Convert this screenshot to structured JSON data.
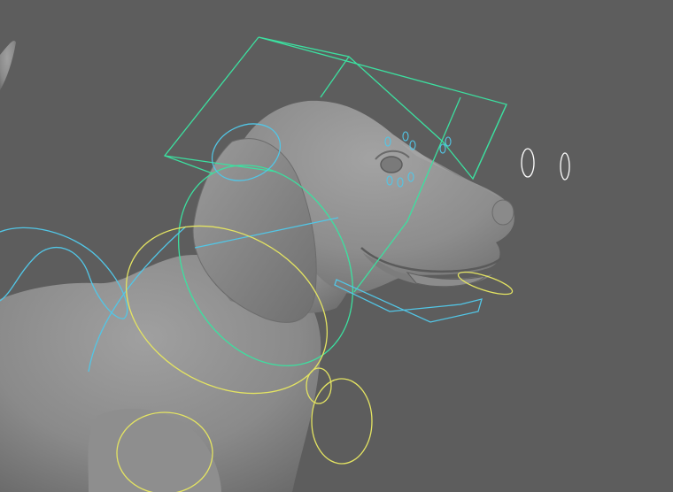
{
  "viewport": {
    "label": "",
    "background_color": "#5d5d5d"
  },
  "model": {
    "name": "",
    "shading_color": "#8e8e8e",
    "shadow_color": "#4f4f4f",
    "highlight_color": "#a2a2a2"
  },
  "rig": {
    "colors": {
      "head_cage": "#3ce0a0",
      "fk_controls": "#52c6e6",
      "ik_controls": "#e4e462",
      "locator": "#ffffff"
    },
    "controls": [
      {
        "name": "head-cage-control",
        "color_key": "head_cage"
      },
      {
        "name": "neck-ring-control",
        "color_key": "head_cage"
      },
      {
        "name": "ear-control",
        "color_key": "fk_controls"
      },
      {
        "name": "eyelid-controls",
        "color_key": "fk_controls"
      },
      {
        "name": "jaw-control",
        "color_key": "fk_controls"
      },
      {
        "name": "spine-controls",
        "color_key": "fk_controls"
      },
      {
        "name": "chest-control",
        "color_key": "ik_controls"
      },
      {
        "name": "shoulder-control",
        "color_key": "ik_controls"
      },
      {
        "name": "front-leg-controls",
        "color_key": "ik_controls"
      },
      {
        "name": "tongue-control",
        "color_key": "ik_controls"
      },
      {
        "name": "eye-aim-locators",
        "color_key": "locator"
      }
    ]
  }
}
